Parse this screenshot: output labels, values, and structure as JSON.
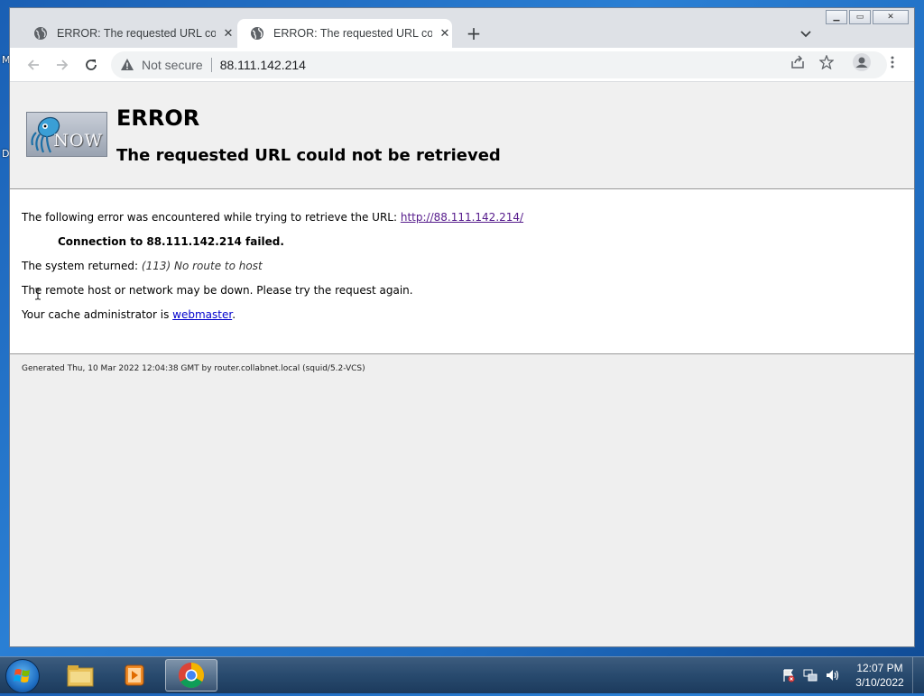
{
  "desktop": {
    "edge_letters": [
      "M",
      "D"
    ]
  },
  "browser": {
    "tabs": [
      {
        "title": "ERROR: The requested URL could not be retrieved",
        "icon": "globe-icon",
        "active": false
      },
      {
        "title": "ERROR: The requested URL could not be retrieved",
        "icon": "globe-icon",
        "active": true
      }
    ],
    "omnibox": {
      "security_label": "Not secure",
      "url": "88.111.142.214"
    }
  },
  "page": {
    "heading": "ERROR",
    "subheading": "The requested URL could not be retrieved",
    "logo_text": "NOW",
    "line1_prefix": "The following error was encountered while trying to retrieve the URL: ",
    "line1_link": "http://88.111.142.214/",
    "line2": "Connection to 88.111.142.214 failed.",
    "line3_prefix": "The system returned: ",
    "line3_detail": "(113) No route to host",
    "line4": "The remote host or network may be down. Please try the request again.",
    "line5_prefix": "Your cache administrator is ",
    "line5_link": "webmaster",
    "line5_suffix": ".",
    "footer": "Generated Thu, 10 Mar 2022 12:04:38 GMT by router.collabnet.local (squid/5.2-VCS)"
  },
  "taskbar": {
    "apps": [
      "windows-explorer",
      "media-player",
      "chrome"
    ],
    "clock_time": "12:07 PM",
    "clock_date": "3/10/2022"
  }
}
